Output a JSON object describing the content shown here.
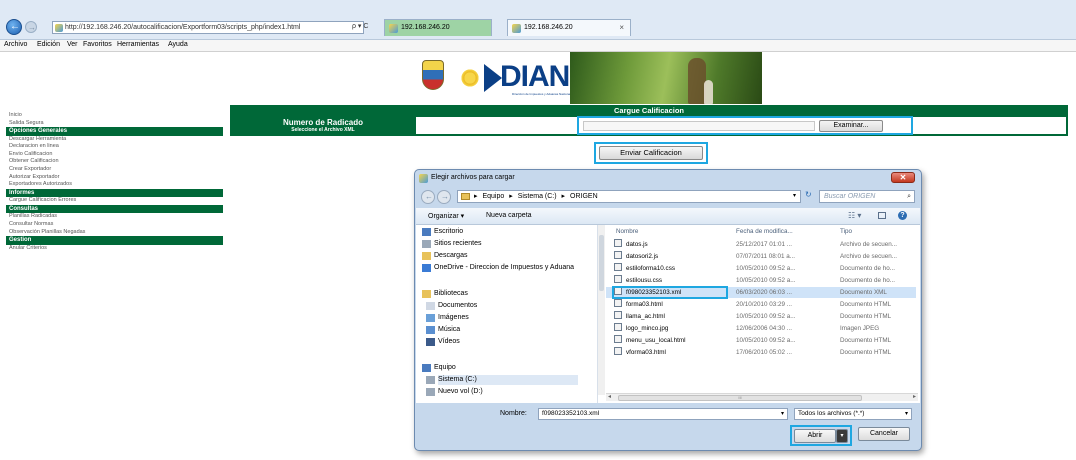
{
  "browser": {
    "url": "http://192.168.246.20/autocalificacion/Exportform03/scripts_php/index1.html",
    "search_icon_label": "ρ ▾ C",
    "tabs": [
      {
        "label": "192.168.246.20"
      },
      {
        "label": "192.168.246.20"
      }
    ],
    "tab_close": "×",
    "menu": [
      "Archivo",
      "Edición",
      "Ver",
      "Favoritos",
      "Herramientas",
      "Ayuda"
    ]
  },
  "logo": {
    "brand": "DIAN",
    "tagline": "Dirección de Impuestos y Aduanas Nacionales"
  },
  "sidebar": {
    "sections": [
      {
        "type": "link",
        "label": "Inicio"
      },
      {
        "type": "link",
        "label": "Salida Segura"
      },
      {
        "type": "head",
        "label": "Opciones Generales"
      },
      {
        "type": "link",
        "label": "Descargar Herramienta"
      },
      {
        "type": "link",
        "label": "Declaracion en linea"
      },
      {
        "type": "link",
        "label": "Envio Calificacion"
      },
      {
        "type": "link",
        "label": "Obtener Calificacion"
      },
      {
        "type": "link",
        "label": "Crear Exportador"
      },
      {
        "type": "link",
        "label": "Autorizar Exportador"
      },
      {
        "type": "link",
        "label": "Exportadores Autorizados"
      },
      {
        "type": "head",
        "label": "Informes"
      },
      {
        "type": "link",
        "label": "Cargue Calificacion Errores"
      },
      {
        "type": "head",
        "label": "Consultas"
      },
      {
        "type": "link",
        "label": "Planillas Radicadas"
      },
      {
        "type": "link",
        "label": "Consultar Normas"
      },
      {
        "type": "link",
        "label": "Observación Planillas Negadas"
      },
      {
        "type": "head",
        "label": "Gestion"
      },
      {
        "type": "link",
        "label": "Anular Criterios"
      }
    ]
  },
  "form": {
    "header": "Cargue Calificacion",
    "radicado_title": "Numero de Radicado",
    "radicado_sub": "Seleccione el Archivo XML",
    "browse_label": "Examinar...",
    "send_label": "Enviar Calificacion"
  },
  "dialog": {
    "title": "Elegir archivos para cargar",
    "close": "✕",
    "path": [
      "Equipo",
      "Sistema (C:)",
      "ORIGEN"
    ],
    "path_separator": "▸",
    "search_placeholder": "Buscar ORIGEN",
    "toolbar": {
      "organize": "Organizar ▾",
      "new_folder": "Nueva carpeta"
    },
    "tree": [
      {
        "label": "Escritorio",
        "icon": "desktop-icon"
      },
      {
        "label": "Sitios recientes",
        "icon": "recent-icon"
      },
      {
        "label": "Descargas",
        "icon": "downloads-icon"
      },
      {
        "label": "OneDrive - Direccion de Impuestos y Aduana",
        "icon": "onedrive-icon"
      },
      {
        "label": "Bibliotecas",
        "icon": "library-icon"
      },
      {
        "label": "Documentos",
        "icon": "documents-icon"
      },
      {
        "label": "Imágenes",
        "icon": "images-icon"
      },
      {
        "label": "Música",
        "icon": "music-icon"
      },
      {
        "label": "Vídeos",
        "icon": "videos-icon"
      },
      {
        "label": "Equipo",
        "icon": "computer-icon"
      },
      {
        "label": "Sistema (C:)",
        "icon": "drive-icon"
      },
      {
        "label": "Nuevo vol (D:)",
        "icon": "drive-icon"
      }
    ],
    "columns": {
      "name": "Nombre",
      "date": "Fecha de modifica...",
      "type": "Tipo"
    },
    "files": [
      {
        "name": "datos.js",
        "date": "25/12/2017 01:01 ...",
        "type": "Archivo de secuen..."
      },
      {
        "name": "datosori2.js",
        "date": "07/07/2011 08:01 a...",
        "type": "Archivo de secuen..."
      },
      {
        "name": "estiloforma10.css",
        "date": "10/05/2010 09:52 a...",
        "type": "Documento de ho..."
      },
      {
        "name": "estilousu.css",
        "date": "10/05/2010 09:52 a...",
        "type": "Documento de ho..."
      },
      {
        "name": "f098023352103.xml",
        "date": "06/03/2020 06:03 ...",
        "type": "Documento XML"
      },
      {
        "name": "forma03.html",
        "date": "20/10/2010 03:29 ...",
        "type": "Documento HTML"
      },
      {
        "name": "llama_ac.html",
        "date": "10/05/2010 09:52 a...",
        "type": "Documento HTML"
      },
      {
        "name": "logo_minco.jpg",
        "date": "12/06/2006 04:30 ...",
        "type": "Imagen JPEG"
      },
      {
        "name": "menu_usu_local.html",
        "date": "10/05/2010 09:52 a...",
        "type": "Documento HTML"
      },
      {
        "name": "vforma03.html",
        "date": "17/06/2010 05:02 ...",
        "type": "Documento HTML"
      }
    ],
    "selected_index": 4,
    "filename_label": "Nombre:",
    "filename_value": "f098023352103.xml",
    "filetype_value": "Todos los archivos (*.*)",
    "open_label": "Abrir",
    "cancel_label": "Cancelar",
    "scroll_arrow_left": "◂",
    "scroll_arrow_right": "▸",
    "scroll_grip": "III"
  },
  "colors": {
    "dian_green": "#006838",
    "highlight_blue": "#1ea7e1",
    "window_chrome": "#dfe9f5"
  }
}
